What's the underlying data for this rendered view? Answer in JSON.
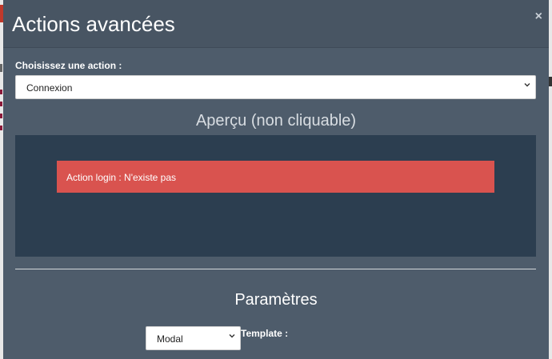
{
  "modal": {
    "title": "Actions avancées",
    "close_label": "×"
  },
  "action": {
    "label": "Choisissez une action :",
    "selected": "Connexion"
  },
  "preview": {
    "title": "Aperçu (non cliquable)",
    "alert_text": "Action login : N'existe pas"
  },
  "parameters": {
    "title": "Paramètres",
    "type_selected": "Modal",
    "template_label": "Template :"
  },
  "colors": {
    "modal_bg": "#4e5c6b",
    "preview_bg": "#2c3e50",
    "alert_bg": "#d9534f"
  }
}
